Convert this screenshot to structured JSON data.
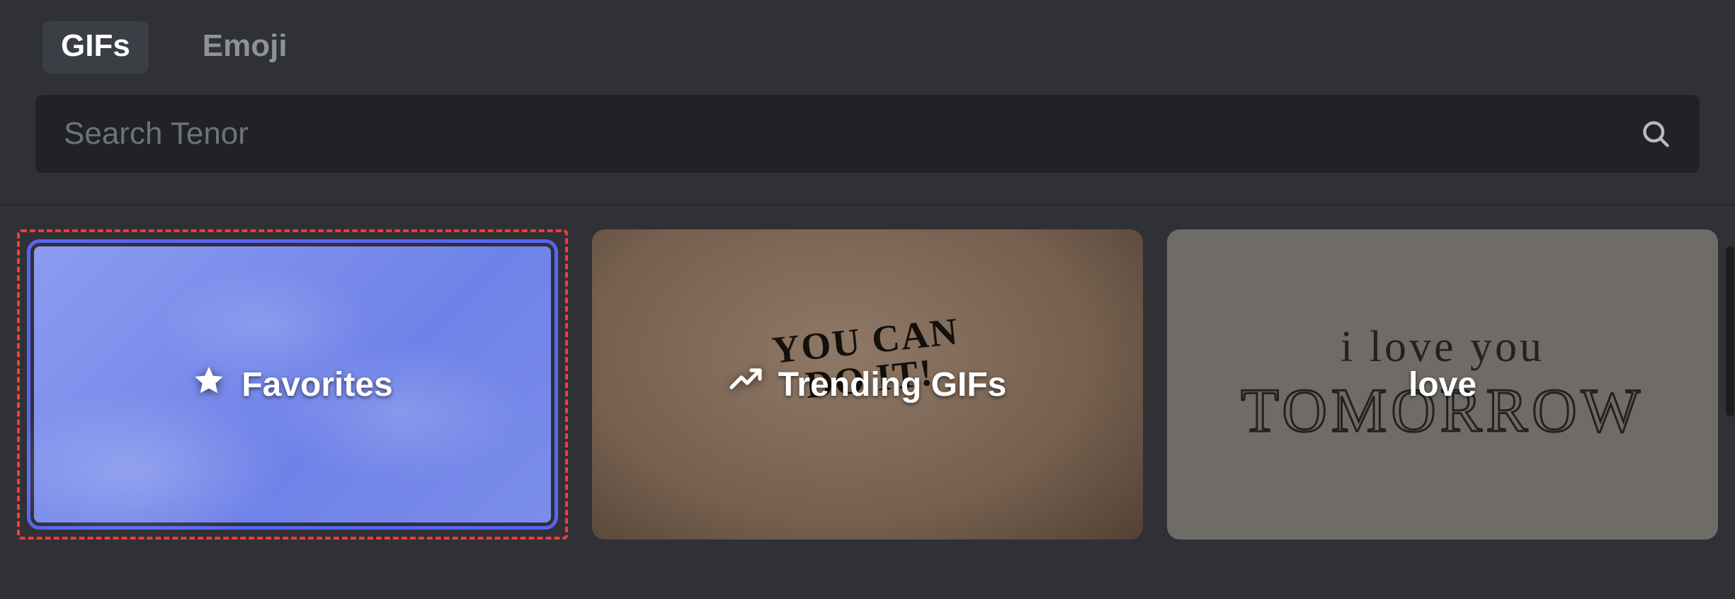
{
  "tabs": {
    "gifs": "GIFs",
    "emoji": "Emoji",
    "active": "gifs"
  },
  "search": {
    "placeholder": "Search Tenor",
    "value": ""
  },
  "cards": [
    {
      "id": "favorites",
      "label": "Favorites",
      "icon": "star-icon",
      "highlighted": true
    },
    {
      "id": "trending",
      "label": "Trending GIFs",
      "icon": "trending-up-icon",
      "bg_text_line1": "YOU CAN",
      "bg_text_line2": "DO IT!"
    },
    {
      "id": "love",
      "label": "love",
      "icon": null,
      "bg_text_line1": "i love you",
      "bg_text_line2": "TOMORROW"
    }
  ],
  "colors": {
    "bg": "#2f3136",
    "search_bg": "#202225",
    "tab_active_bg": "#3b3e44",
    "favorites_accent": "#7b8eea",
    "highlight_dash": "#ff3b30"
  }
}
